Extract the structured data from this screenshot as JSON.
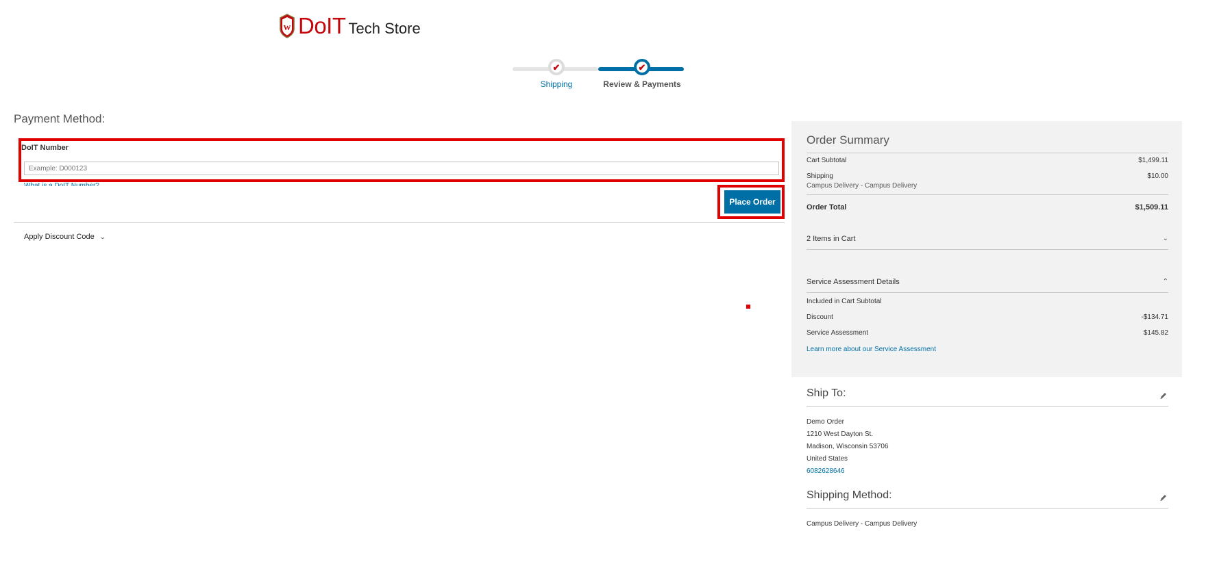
{
  "header": {
    "logo_brand": "DoIT",
    "logo_product": "Tech Store"
  },
  "progress": {
    "steps": [
      {
        "label": "Shipping",
        "state": "complete"
      },
      {
        "label": "Review & Payments",
        "state": "current"
      }
    ]
  },
  "payment": {
    "title": "Payment Method:",
    "doit_label": "DoIT Number",
    "doit_placeholder": "Example: D000123",
    "doit_value": "",
    "help_link": "What is a DoIT Number?",
    "place_order_label": "Place Order",
    "discount_label": "Apply Discount Code"
  },
  "summary": {
    "title": "Order Summary",
    "cart_subtotal_label": "Cart Subtotal",
    "cart_subtotal_value": "$1,499.11",
    "shipping_label": "Shipping",
    "shipping_value": "$10.00",
    "shipping_method": "Campus Delivery - Campus Delivery",
    "order_total_label": "Order Total",
    "order_total_value": "$1,509.11",
    "items_in_cart": "2 Items in Cart",
    "service_title": "Service Assessment Details",
    "included_note": "Included in Cart Subtotal",
    "discount_label": "Discount",
    "discount_value": "-$134.71",
    "service_label": "Service Assessment",
    "service_value": "$145.82",
    "learn_more": "Learn more about our Service Assessment"
  },
  "ship_to": {
    "title": "Ship To:",
    "name": "Demo Order",
    "street": "1210 West Dayton St.",
    "city_line": "Madison, Wisconsin 53706",
    "country": "United States",
    "phone": "6082628646"
  },
  "shipping_method": {
    "title": "Shipping Method:",
    "value": "Campus Delivery - Campus Delivery"
  },
  "colors": {
    "brand_red": "#c5050c",
    "accent_blue": "#006fa6",
    "highlight_red": "#e00000"
  }
}
